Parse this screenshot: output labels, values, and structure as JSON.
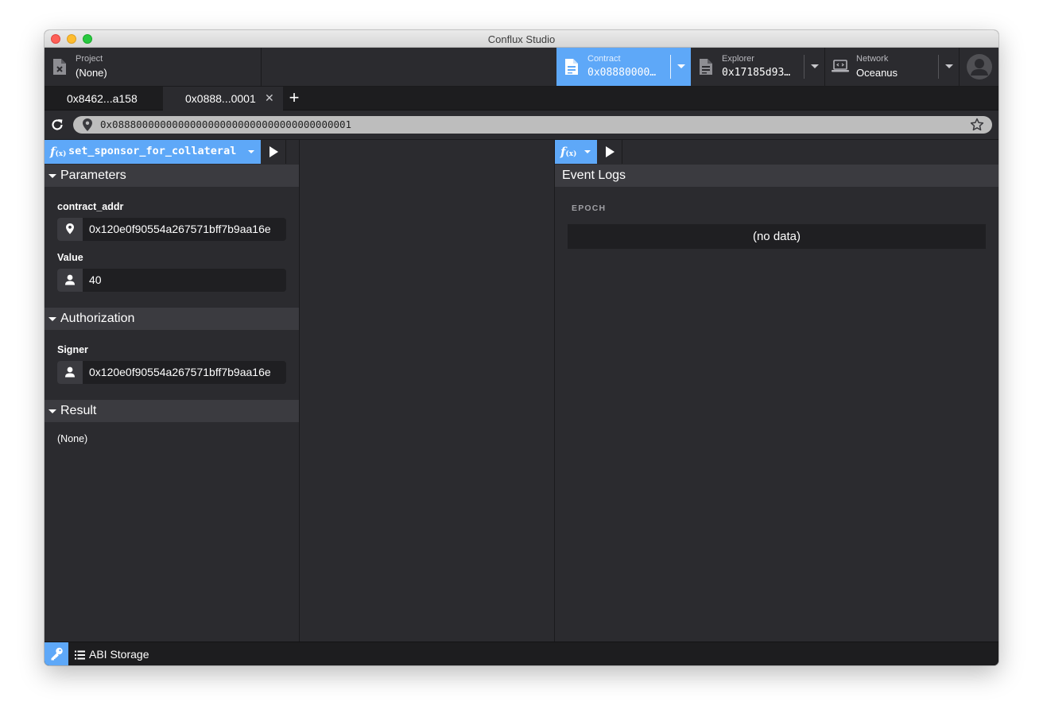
{
  "window": {
    "title": "Conflux Studio"
  },
  "header": {
    "project": {
      "label": "Project",
      "value": "(None)"
    },
    "contract": {
      "label": "Contract",
      "value": "0x08880000…"
    },
    "explorer": {
      "label": "Explorer",
      "value": "0x17185d93…"
    },
    "network": {
      "label": "Network",
      "value": "Oceanus"
    }
  },
  "tabs": [
    {
      "label": "0x8462...a158",
      "active": false
    },
    {
      "label": "0x0888...0001",
      "active": true,
      "close": "✕"
    }
  ],
  "tab_add": "+",
  "address": {
    "value": "0x0888000000000000000000000000000000000001"
  },
  "left_panel": {
    "function": {
      "name": "set_sponsor_for_collateral",
      "fx_main": "f",
      "fx_sub": "(x)"
    },
    "parameters": {
      "title": "Parameters",
      "fields": [
        {
          "label": "contract_addr",
          "value": "0x120e0f90554a267571bff7b9aa16e",
          "icon": "map-pin-icon"
        },
        {
          "label": "Value",
          "value": "40",
          "icon": "user-icon"
        }
      ]
    },
    "authorization": {
      "title": "Authorization",
      "signer": {
        "label": "Signer",
        "value": "0x120e0f90554a267571bff7b9aa16e",
        "icon": "user-icon"
      }
    },
    "result": {
      "title": "Result",
      "value": "(None)"
    }
  },
  "right_panel": {
    "function": {
      "fx_main": "f",
      "fx_sub": "(x)"
    },
    "event_logs": {
      "title": "Event Logs",
      "column": "EPOCH",
      "empty": "(no data)"
    }
  },
  "bottom": {
    "abi_storage": "ABI Storage"
  },
  "colors": {
    "accent": "#5ea8f8",
    "panel_bg": "#2b2b2f",
    "section_bg": "#3b3b40",
    "dark_bg": "#1d1d1f"
  }
}
